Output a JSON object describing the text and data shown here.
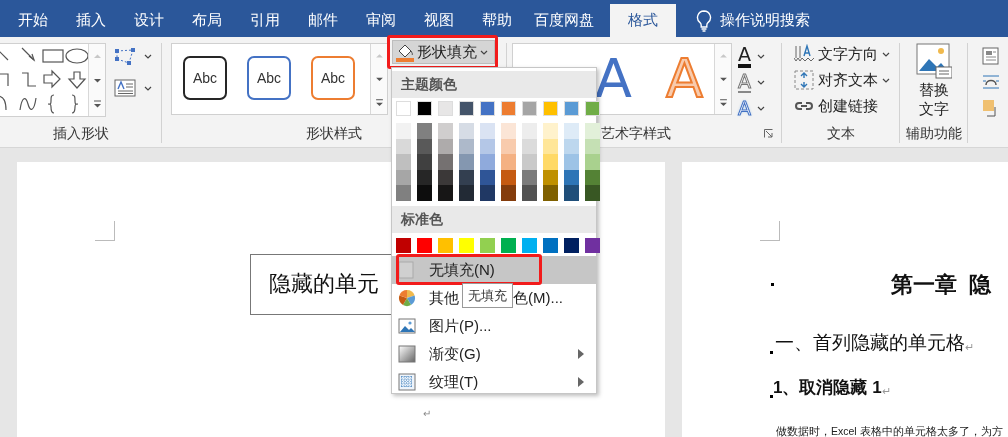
{
  "tabs": [
    {
      "label": "开始",
      "selected": false
    },
    {
      "label": "插入",
      "selected": false
    },
    {
      "label": "设计",
      "selected": false
    },
    {
      "label": "布局",
      "selected": false
    },
    {
      "label": "引用",
      "selected": false
    },
    {
      "label": "邮件",
      "selected": false
    },
    {
      "label": "审阅",
      "selected": false
    },
    {
      "label": "视图",
      "selected": false
    },
    {
      "label": "帮助",
      "selected": false
    },
    {
      "label": "百度网盘",
      "selected": false
    },
    {
      "label": "格式",
      "selected": true
    }
  ],
  "tell_me": {
    "label": "操作说明搜索"
  },
  "ribbon": {
    "groups": [
      {
        "kind": "shapes",
        "label": "插入形状"
      },
      {
        "kind": "styles",
        "label": "形状样式",
        "styles": [
          {
            "label": "Abc",
            "color": "#262626"
          },
          {
            "label": "Abc",
            "color": "#4472c4"
          },
          {
            "label": "Abc",
            "color": "#ed7d31"
          }
        ],
        "fill_button": {
          "label": "形状填充",
          "highlighted": true
        }
      },
      {
        "kind": "wordart",
        "label": "艺术字样式",
        "wordart": [
          {
            "label": "A",
            "kind": "solid",
            "color": "#4472c4"
          },
          {
            "label": "A",
            "kind": "outline",
            "color": "#f8cbad"
          }
        ],
        "text_tools": [
          {
            "label": "A",
            "kind": "fill"
          },
          {
            "label": "A",
            "kind": "outline"
          },
          {
            "label": "A",
            "kind": "effects"
          }
        ]
      },
      {
        "kind": "text",
        "label": "文本",
        "commands": [
          {
            "label": "文字方向",
            "kind": "direction",
            "dropdown": true
          },
          {
            "label": "对齐文本",
            "kind": "align",
            "dropdown": true
          },
          {
            "label": "创建链接",
            "kind": "link",
            "dropdown": false
          }
        ]
      },
      {
        "kind": "accessibility",
        "label": "辅助功能",
        "command": {
          "lines": [
            "替换",
            "文字"
          ]
        }
      },
      {
        "kind": "arrange"
      }
    ]
  },
  "fill_menu": {
    "theme": {
      "title": "主题颜色",
      "columns": [
        {
          "color": "#ffffff",
          "shades": [
            {
              "color": "#f2f2f2"
            },
            {
              "color": "#d9d9d9"
            },
            {
              "color": "#bfbfbf"
            },
            {
              "color": "#a6a6a6"
            },
            {
              "color": "#808080"
            }
          ]
        },
        {
          "color": "#000000",
          "shades": [
            {
              "color": "#808080"
            },
            {
              "color": "#595959"
            },
            {
              "color": "#404040"
            },
            {
              "color": "#262626"
            },
            {
              "color": "#0d0d0d"
            }
          ]
        },
        {
          "color": "#e7e6e6",
          "shades": [
            {
              "color": "#d0cece"
            },
            {
              "color": "#aeabab"
            },
            {
              "color": "#757171"
            },
            {
              "color": "#3b3838"
            },
            {
              "color": "#171616"
            }
          ]
        },
        {
          "color": "#44546a",
          "shades": [
            {
              "color": "#d6dce5"
            },
            {
              "color": "#adb9ca"
            },
            {
              "color": "#8497b0"
            },
            {
              "color": "#333f50"
            },
            {
              "color": "#222a35"
            }
          ]
        },
        {
          "color": "#4472c4",
          "shades": [
            {
              "color": "#dae3f3"
            },
            {
              "color": "#b4c7e7"
            },
            {
              "color": "#8faadc"
            },
            {
              "color": "#2f5597"
            },
            {
              "color": "#203864"
            }
          ]
        },
        {
          "color": "#ed7d31",
          "shades": [
            {
              "color": "#fbe5d6"
            },
            {
              "color": "#f8cbad"
            },
            {
              "color": "#f4b183"
            },
            {
              "color": "#c55a11"
            },
            {
              "color": "#843c0c"
            }
          ]
        },
        {
          "color": "#a5a5a5",
          "shades": [
            {
              "color": "#ededed"
            },
            {
              "color": "#dbdbdb"
            },
            {
              "color": "#c9c9c9"
            },
            {
              "color": "#7b7b7b"
            },
            {
              "color": "#525252"
            }
          ]
        },
        {
          "color": "#ffc000",
          "shades": [
            {
              "color": "#fff2cc"
            },
            {
              "color": "#ffe699"
            },
            {
              "color": "#ffd966"
            },
            {
              "color": "#bf9000"
            },
            {
              "color": "#7f6000"
            }
          ]
        },
        {
          "color": "#5b9bd5",
          "shades": [
            {
              "color": "#deebf7"
            },
            {
              "color": "#bdd7ee"
            },
            {
              "color": "#9dc3e6"
            },
            {
              "color": "#2e75b6"
            },
            {
              "color": "#1f4e79"
            }
          ]
        },
        {
          "color": "#70ad47",
          "shades": [
            {
              "color": "#e2f0d9"
            },
            {
              "color": "#c5e0b4"
            },
            {
              "color": "#a9d18e"
            },
            {
              "color": "#548235"
            },
            {
              "color": "#385723"
            }
          ]
        }
      ]
    },
    "standard": {
      "title": "标准色",
      "colors": [
        {
          "color": "#c00000"
        },
        {
          "color": "#ff0000"
        },
        {
          "color": "#ffc000"
        },
        {
          "color": "#ffff00"
        },
        {
          "color": "#92d050"
        },
        {
          "color": "#00b050"
        },
        {
          "color": "#00b0f0"
        },
        {
          "color": "#0070c0"
        },
        {
          "color": "#002060"
        },
        {
          "color": "#7030a0"
        }
      ]
    },
    "items": [
      {
        "kind": "none",
        "label": "无填充(N)",
        "selected": true,
        "highlighted": true,
        "submenu": false
      },
      {
        "kind": "more",
        "label_parts": [
          "其他",
          "色(M)..."
        ],
        "selected": false,
        "highlighted": false,
        "submenu": false
      },
      {
        "kind": "picture",
        "label": "图片(P)...",
        "selected": false,
        "highlighted": false,
        "submenu": false
      },
      {
        "kind": "gradient",
        "label": "渐变(G)",
        "selected": false,
        "highlighted": false,
        "submenu": true
      },
      {
        "kind": "texture",
        "label": "纹理(T)",
        "selected": false,
        "highlighted": false,
        "submenu": true
      }
    ],
    "tooltip": {
      "text": "无填充"
    }
  },
  "pages": [
    {
      "textbox": "隐藏的单元",
      "return_mark": "↵"
    },
    {
      "heading": "第一章  隐",
      "paragraphs": [
        {
          "kind": "h2",
          "text": "一、首列隐藏的单元格",
          "mark": "↵"
        },
        {
          "kind": "h3",
          "text": "1、取消隐藏 1",
          "mark": "↵"
        }
      ],
      "body": "做数据时，Excel 表格中的单元格太多了，为方"
    }
  ]
}
